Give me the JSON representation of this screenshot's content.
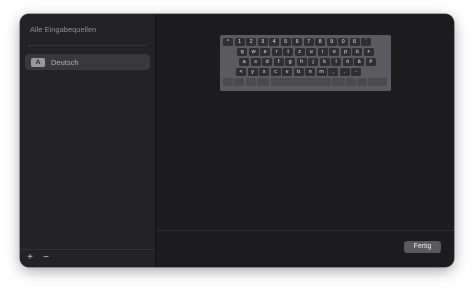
{
  "sidebar": {
    "title": "Alle Eingabequellen",
    "sources": [
      {
        "badge": "A",
        "label": "Deutsch",
        "selected": true
      }
    ],
    "add_label": "+",
    "remove_label": "−"
  },
  "keyboard": {
    "rows": [
      [
        "^",
        "1",
        "2",
        "3",
        "4",
        "5",
        "6",
        "7",
        "8",
        "9",
        "0",
        "ß",
        "´"
      ],
      [
        "q",
        "w",
        "e",
        "r",
        "t",
        "z",
        "u",
        "i",
        "o",
        "p",
        "ü",
        "+"
      ],
      [
        "a",
        "s",
        "d",
        "f",
        "g",
        "h",
        "j",
        "k",
        "l",
        "ö",
        "ä",
        "#"
      ],
      [
        "<",
        "y",
        "x",
        "c",
        "v",
        "b",
        "n",
        "m",
        ",",
        ".",
        "-"
      ]
    ]
  },
  "footer": {
    "done_label": "Fertig"
  },
  "colors": {
    "window_bg": "#1c1c1e",
    "sidebar_bg": "#232325",
    "keyboard_bg": "#5b5b5f",
    "key_bg": "#2f2f31",
    "button_bg": "#5a5a5e"
  }
}
